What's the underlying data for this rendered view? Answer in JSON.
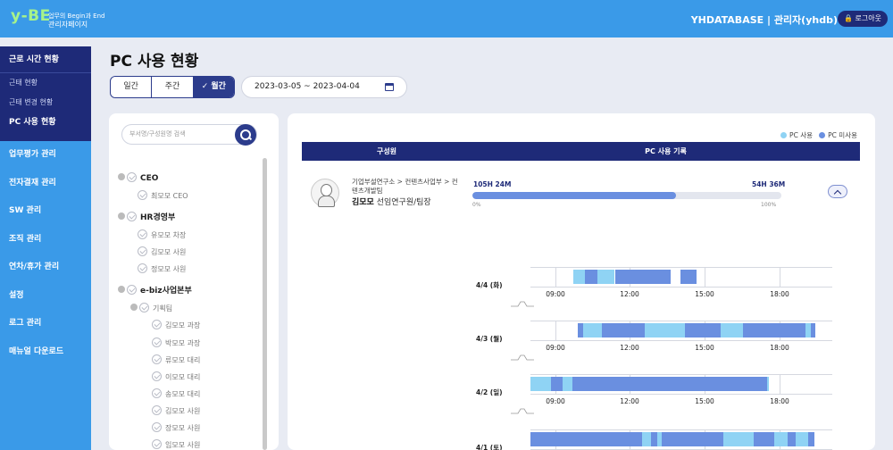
{
  "header": {
    "logo": "y-BE",
    "logo_sub1": "업무의 Begin과 End",
    "logo_sub2": "관리자페이지",
    "org_user": "YHDATABASE | 관리자(yhdb)",
    "logout": "로그아웃"
  },
  "sidebar": {
    "group_title": "근로 시간 현황",
    "subs": [
      {
        "label": "근태 현황"
      },
      {
        "label": "근태 변경 현황"
      },
      {
        "label": "PC 사용 현황"
      }
    ],
    "items": [
      {
        "label": "업무평가 관리"
      },
      {
        "label": "전자결재 관리"
      },
      {
        "label": "SW 관리"
      },
      {
        "label": "조직 관리"
      },
      {
        "label": "연차/휴가 관리"
      },
      {
        "label": "설정"
      },
      {
        "label": "로그 관리"
      },
      {
        "label": "매뉴얼 다운로드"
      }
    ]
  },
  "main": {
    "title": "PC 사용 현황",
    "period_tabs": [
      "일간",
      "주간",
      "월간"
    ],
    "selected_period": "월간",
    "date_range": "2023-03-05 ~ 2023-04-04"
  },
  "tree": {
    "search_placeholder": "부서명/구성원명 검색",
    "nodes": [
      {
        "label": "CEO"
      },
      {
        "label": "최모모 CEO"
      },
      {
        "label": "HR경영부"
      },
      {
        "label": "유모모 차장"
      },
      {
        "label": "김모모 사원"
      },
      {
        "label": "정모모 사원"
      },
      {
        "label": "e-biz사업본부"
      },
      {
        "label": "기획팀"
      },
      {
        "label": "김모모 과장"
      },
      {
        "label": "박모모 과장"
      },
      {
        "label": "류모모 대리"
      },
      {
        "label": "이모모 대리"
      },
      {
        "label": "송모모 대리"
      },
      {
        "label": "김모모 사원"
      },
      {
        "label": "장모모 사원"
      },
      {
        "label": "임모모 사원"
      }
    ]
  },
  "record": {
    "legend_used": "PC 사용",
    "legend_unused": "PC 미사용",
    "col_member": "구성원",
    "col_record": "PC 사용 기록",
    "dept": "기업부설연구소 > 컨텐츠사업부 > 컨텐츠개발팀",
    "name": "김모모",
    "position": "선임연구원/팀장",
    "used_time": "105H 24M",
    "unused_time": "54H 36M",
    "used_ratio": 0.66,
    "pct_min": "0%",
    "pct_max": "100%",
    "time_labels": [
      "09:00",
      "12:00",
      "15:00",
      "18:00"
    ],
    "colors": {
      "used": "#8fd3f4",
      "unused": "#6a8fe0"
    },
    "days": [
      {
        "label": "4/4 (화)"
      },
      {
        "label": "4/3 (월)"
      },
      {
        "label": "4/2 (일)"
      },
      {
        "label": "4/1 (토)"
      }
    ]
  }
}
